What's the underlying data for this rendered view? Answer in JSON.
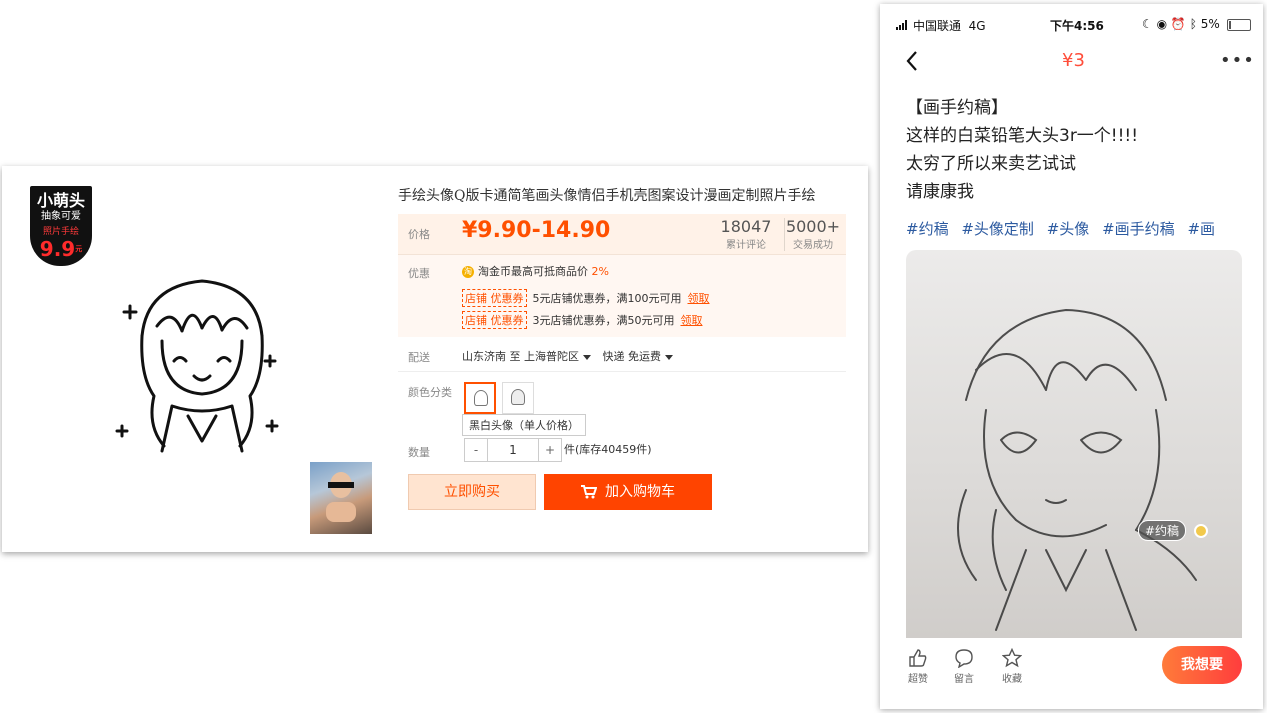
{
  "left_product": {
    "badge": {
      "title": "小萌头",
      "subtitle": "抽象可爱",
      "red_text": "照片手绘",
      "price": "9.9",
      "yuan": "元"
    },
    "title": "手绘头像Q版卡通简笔画头像情侣手机壳图案设计漫画定制照片手绘",
    "price": {
      "label": "价格",
      "value": "¥9.90-14.90"
    },
    "stats": [
      {
        "num": "18047",
        "label": "累计评论"
      },
      {
        "num": "5000+",
        "label": "交易成功"
      }
    ],
    "promo": {
      "label": "优惠",
      "coin_icon": "淘",
      "coin_text": "淘金币最高可抵商品价",
      "coin_pct": "2%",
      "coupons": [
        {
          "tag": "店铺 优惠券",
          "text": "5元店铺优惠券，满100元可用",
          "link": "领取"
        },
        {
          "tag": "店铺 优惠券",
          "text": "3元店铺优惠券，满50元可用",
          "link": "领取"
        }
      ]
    },
    "shipping": {
      "label": "配送",
      "from": "山东济南 至",
      "to": "上海普陀区",
      "method": "快递 免运费"
    },
    "color": {
      "label": "颜色分类",
      "tooltip": "黑白头像（单人价格）"
    },
    "quantity": {
      "label": "数量",
      "minus": "-",
      "value": "1",
      "plus": "+",
      "stock": "件(库存40459件)"
    },
    "buttons": {
      "buy": "立即购买",
      "cart": "加入购物车"
    }
  },
  "phone": {
    "status": {
      "carrier": "中国联通",
      "network": "4G",
      "time": "下午4:56",
      "battery": "5%"
    },
    "nav": {
      "price": "¥3"
    },
    "post_lines": [
      "【画手约稿】",
      "这样的白菜铅笔大头3r一个!!!!",
      "太穷了所以来卖艺试试",
      "请康康我"
    ],
    "tags": [
      "#约稿",
      "#头像定制",
      "#头像",
      "#画手约稿",
      "#画"
    ],
    "photo_tag": "#约稿",
    "actions": [
      "超赞",
      "留言",
      "收藏"
    ],
    "want_button": "我想要"
  },
  "colors": {
    "taobao_orange": "#ff5000",
    "xianyu_red": "#ff4d3a",
    "tag_blue": "#2c5aa0"
  }
}
